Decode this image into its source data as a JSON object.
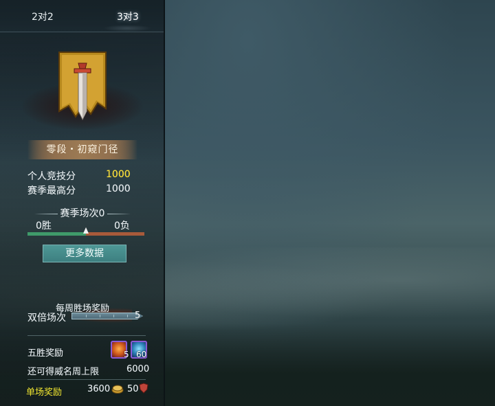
{
  "tabs": [
    "2对2",
    "3对3"
  ],
  "panels": [
    {
      "active_tab": 0
    },
    {
      "active_tab": 1
    },
    {
      "active_tab": 1
    }
  ],
  "rank_name": "零段・初窥门径",
  "stats": {
    "personal_label": "个人竞技分",
    "personal_value": "1000",
    "season_high_label": "赛季最高分",
    "season_high_value": "1000"
  },
  "season": {
    "matches_label": "赛季场次0",
    "wins": "0胜",
    "losses": "0负",
    "win_fraction": 0.5
  },
  "more_button": "更多数据",
  "weekly": {
    "title": "每周胜场奖励",
    "double_label": "双倍场次",
    "double_count": "5"
  },
  "five_win": {
    "label": "五胜奖励",
    "item1_count": "5",
    "item2_count": "60"
  },
  "limit": {
    "label": "还可得威名周上限",
    "value": "6000"
  },
  "single": {
    "label": "单场奖励",
    "coin": "3600",
    "shield": "50"
  },
  "colors": {
    "gold_text": "#ffe23a",
    "win_bar": "#3f9a6a",
    "loss_bar": "#a85a3a",
    "button": "#4e9896",
    "single_label": "#e2d92f"
  }
}
